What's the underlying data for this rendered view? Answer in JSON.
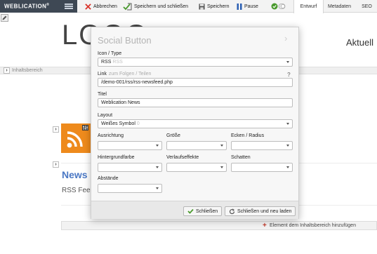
{
  "toolbar": {
    "brand": "WEBLICATION",
    "brand_mark": "®",
    "abbrechen": "Abbrechen",
    "speichern_schliessen": "Speichern und schließen",
    "speichern": "Speichern",
    "pause": "Pause",
    "tabs": [
      "Entwurf",
      "Metadaten",
      "SEO"
    ]
  },
  "page": {
    "logo": "LOGO",
    "aktuell": "Aktuell",
    "inhaltsbereich": "Inhaltsbereich",
    "news_title": "News :",
    "rss_feed": "RSS Feed",
    "add_element": "Element dem Inhaltsbereich hinzufügen"
  },
  "dialog": {
    "title": "Social Button",
    "icon_type": {
      "label": "Icon / Type",
      "value": "RSS",
      "ghost": "RSS"
    },
    "link": {
      "label": "Link",
      "hint": "zum Folgen / Teilen",
      "value": "/demo-001/rss/rss-newsfeed.php",
      "help": "?"
    },
    "titel": {
      "label": "Titel",
      "value": "Weblication News"
    },
    "layout": {
      "label": "Layout",
      "value": "Weißes Symbol",
      "ghost": "0"
    },
    "ausrichtung": {
      "label": "Ausrichtung",
      "value": ""
    },
    "groesse": {
      "label": "Größe",
      "value": ""
    },
    "ecken": {
      "label": "Ecken / Radius",
      "value": ""
    },
    "hintergrundfarbe": {
      "label": "Hintergrundfarbe",
      "value": ""
    },
    "verlaufseffekte": {
      "label": "Verlaufseffekte",
      "value": ""
    },
    "schatten": {
      "label": "Schatten",
      "value": ""
    },
    "abstaende": {
      "label": "Abstände",
      "value": ""
    },
    "btn_close": "Schließen",
    "btn_close_reload": "Schließen und neu laden"
  },
  "colors": {
    "brand_bg": "#3e4854",
    "rss_orange": "#ee8a1c",
    "news_blue": "#4b78c4",
    "cancel_red": "#d9342b",
    "ok_green": "#4a9a2e",
    "pause_blue": "#2b5fb3"
  },
  "icons": [
    "menu-icon",
    "close-x-icon",
    "save-close-icon",
    "save-icon",
    "pause-icon",
    "check-toggle-icon",
    "pencil-icon",
    "chevron-right-icon",
    "rss-icon",
    "tools-icon",
    "plus-icon",
    "check-icon",
    "reload-icon"
  ]
}
